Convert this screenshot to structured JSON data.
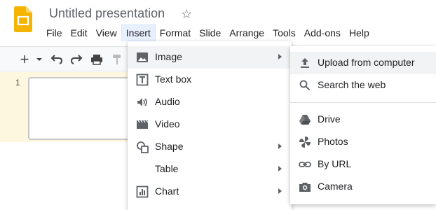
{
  "app": {
    "title": "Untitled presentation",
    "logo_icon": "google-slides-logo",
    "accent": "#f4b400"
  },
  "menubar": [
    "File",
    "Edit",
    "View",
    "Insert",
    "Format",
    "Slide",
    "Arrange",
    "Tools",
    "Add-ons",
    "Help"
  ],
  "active_menu": "Insert",
  "toolbar": {
    "buttons": [
      "plus-icon",
      "dropdown-icon",
      "undo-icon",
      "redo-icon",
      "print-icon",
      "paint-format-icon"
    ]
  },
  "filmstrip": {
    "slide_number": "1",
    "selected_color": "#fef7e0"
  },
  "insert_menu": {
    "items": [
      {
        "label": "Image",
        "icon": "image-icon",
        "has_submenu": true,
        "highlighted": true
      },
      {
        "label": "Text box",
        "icon": "text-box-icon",
        "has_submenu": false
      },
      {
        "label": "Audio",
        "icon": "audio-icon",
        "has_submenu": false
      },
      {
        "label": "Video",
        "icon": "video-icon",
        "has_submenu": false
      },
      {
        "label": "Shape",
        "icon": "shape-icon",
        "has_submenu": true
      },
      {
        "label": "Table",
        "icon": "",
        "has_submenu": true
      },
      {
        "label": "Chart",
        "icon": "chart-icon",
        "has_submenu": true
      }
    ]
  },
  "image_submenu": {
    "items": [
      {
        "label": "Upload from computer",
        "icon": "upload-icon",
        "highlighted": true
      },
      {
        "label": "Search the web",
        "icon": "search-icon"
      },
      {
        "label": "Drive",
        "icon": "drive-icon"
      },
      {
        "label": "Photos",
        "icon": "photos-icon"
      },
      {
        "label": "By URL",
        "icon": "link-icon"
      },
      {
        "label": "Camera",
        "icon": "camera-icon"
      }
    ]
  }
}
